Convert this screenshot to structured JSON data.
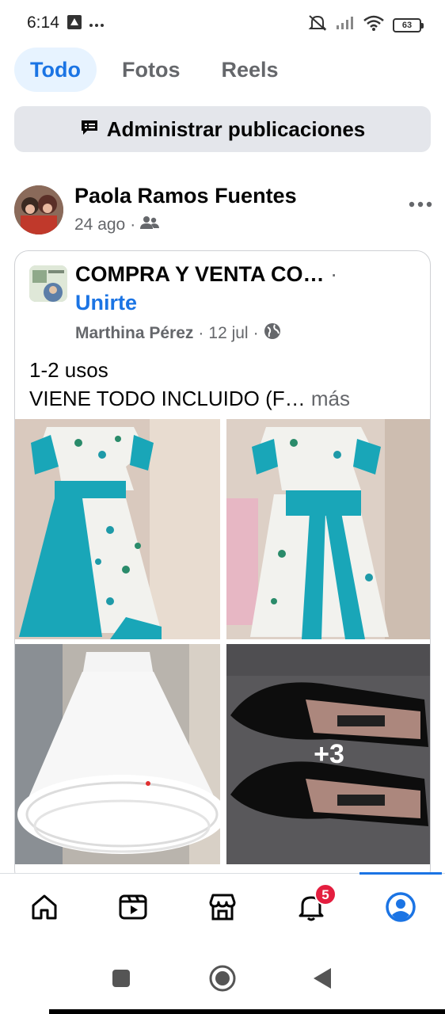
{
  "status_bar": {
    "time": "6:14",
    "battery": "63"
  },
  "tabs": [
    {
      "label": "Todo",
      "active": true
    },
    {
      "label": "Fotos",
      "active": false
    },
    {
      "label": "Reels",
      "active": false
    }
  ],
  "manage_button": {
    "label": "Administrar publicaciones",
    "icon": "manage-posts-icon"
  },
  "post": {
    "author": "Paola Ramos Fuentes",
    "time": "24 ago",
    "separator": "·",
    "audience_icon": "friends-icon",
    "more_icon": "more-horizontal-icon",
    "shared": {
      "group_name": "COMPRA Y VENTA CO…",
      "separator": "·",
      "join_label": "Unirte",
      "original_author": "Marthina Pérez",
      "date": "12 jul",
      "audience_icon": "globe-icon",
      "text_line1": "1-2 usos",
      "text_line2": "VIENE TODO INCLUIDO (F…",
      "more_label": "más",
      "photos": [
        {
          "name": "dress-front"
        },
        {
          "name": "dress-back"
        },
        {
          "name": "petticoat"
        },
        {
          "name": "shoes",
          "overlay": "+3"
        }
      ]
    }
  },
  "bottom_nav": {
    "items": [
      {
        "name": "home",
        "icon": "home-icon"
      },
      {
        "name": "video",
        "icon": "video-icon"
      },
      {
        "name": "marketplace",
        "icon": "marketplace-icon"
      },
      {
        "name": "notifications",
        "icon": "bell-icon",
        "badge": "5"
      },
      {
        "name": "profile",
        "icon": "profile-icon",
        "active": true
      }
    ]
  },
  "colors": {
    "accent": "#1b74e4",
    "badge": "#e41e3f",
    "text_secondary": "#65676b"
  }
}
